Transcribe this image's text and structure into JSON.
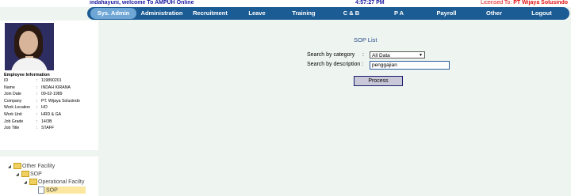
{
  "topbar": {
    "welcome": "indahayuni, welcome To AMPUH Online",
    "time": "4:57:27 PM",
    "license_prefix": "Licensed To: ",
    "license_company": "PT Wijaya Solusindo"
  },
  "menu": [
    {
      "label": "Sys. Admin",
      "active": true
    },
    {
      "label": "Administration"
    },
    {
      "label": "Recruitment"
    },
    {
      "label": "Leave"
    },
    {
      "label": "Training"
    },
    {
      "label": "C & B"
    },
    {
      "label": "P A"
    },
    {
      "label": "Payroll"
    },
    {
      "label": "Other"
    },
    {
      "label": "Logout"
    }
  ],
  "employee": {
    "heading": "Employee Information",
    "fields": [
      {
        "key": "ID",
        "value": "119890201"
      },
      {
        "key": "Name",
        "value": "INDAH KIRANA"
      },
      {
        "key": "Join Date",
        "value": "09-02-1989"
      },
      {
        "key": "Company",
        "value": "PT. Wijaya Solusindo"
      },
      {
        "key": "Work Location",
        "value": "HO"
      },
      {
        "key": "Work Unit",
        "value": "HRD & GA"
      },
      {
        "key": "Job Grade",
        "value": "14/3B"
      },
      {
        "key": "Job Title",
        "value": "STAFF"
      }
    ]
  },
  "tree": {
    "other_facility": "Other Facility",
    "sop": "SOP",
    "operational_facility": "Operational Facilty",
    "sop_leaf": "SOP"
  },
  "main": {
    "title": "SOP List",
    "category_label": "Search by category",
    "category_value": "All Data",
    "description_label": "Search by description :",
    "description_value": "penggajian",
    "process_label": "Process"
  }
}
